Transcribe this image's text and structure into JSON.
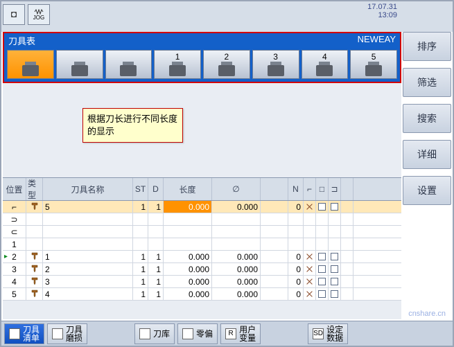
{
  "datetime": {
    "date": "17.07.31",
    "time": "13:09"
  },
  "topbar": {
    "mode_label": "JOG"
  },
  "magazine": {
    "title": "刀具表",
    "brand": "NEWEAY",
    "slots": [
      {
        "label": "",
        "active": true
      },
      {
        "label": ""
      },
      {
        "label": ""
      },
      {
        "label": "1"
      },
      {
        "label": "2"
      },
      {
        "label": "3"
      },
      {
        "label": "4"
      },
      {
        "label": "5"
      }
    ]
  },
  "callout": {
    "text": "根据刀长进行不同长度的显示"
  },
  "sidebar": {
    "items": [
      {
        "label": "排序"
      },
      {
        "label": "筛选"
      },
      {
        "label": "搜索"
      },
      {
        "label": "详细"
      },
      {
        "label": "设置"
      }
    ]
  },
  "table": {
    "headers": {
      "pos": "位置",
      "type": "类型",
      "name": "刀具名称",
      "st": "ST",
      "d": "D",
      "len": "长度",
      "dia": "∅",
      "n": "N"
    },
    "rows": [
      {
        "pos": "⌐",
        "name": "5",
        "st": "1",
        "d": "1",
        "len": "0.000",
        "dia": "0.000",
        "n": "0",
        "sel": true
      },
      {
        "pos": "⊃",
        "empty": true
      },
      {
        "pos": "⊂",
        "empty": true
      },
      {
        "pos": "1",
        "empty": true
      },
      {
        "pos": "2",
        "name": "1",
        "st": "1",
        "d": "1",
        "len": "0.000",
        "dia": "0.000",
        "n": "0",
        "marker": true
      },
      {
        "pos": "3",
        "name": "2",
        "st": "1",
        "d": "1",
        "len": "0.000",
        "dia": "0.000",
        "n": "0"
      },
      {
        "pos": "4",
        "name": "3",
        "st": "1",
        "d": "1",
        "len": "0.000",
        "dia": "0.000",
        "n": "0"
      },
      {
        "pos": "5",
        "name": "4",
        "st": "1",
        "d": "1",
        "len": "0.000",
        "dia": "0.000",
        "n": "0"
      }
    ]
  },
  "bottombar": {
    "items": [
      {
        "label": "刀具\n清单",
        "active": true
      },
      {
        "label": "刀具\n磨损"
      },
      {
        "label": "刀库"
      },
      {
        "label": "零偏"
      },
      {
        "label": "用户\n变量",
        "badge": "R"
      },
      {
        "label": "设定\n数据",
        "badge": "SD"
      }
    ]
  },
  "watermark": "cnshare.cn"
}
